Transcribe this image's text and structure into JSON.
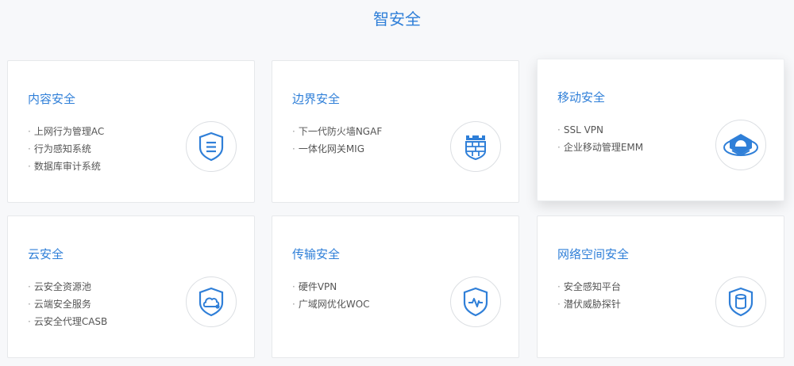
{
  "page": {
    "title": "智安全"
  },
  "colors": {
    "accent": "#2f7fd8",
    "text": "#555555",
    "card_border": "#e6e8eb"
  },
  "cards": [
    {
      "title": "内容安全",
      "icon": "shield-document-icon",
      "items": [
        "上网行为管理AC",
        "行为感知系统",
        "数据库审计系统"
      ]
    },
    {
      "title": "边界安全",
      "icon": "firewall-icon",
      "items": [
        "下一代防火墙NGAF",
        "一体化网关MIG"
      ]
    },
    {
      "title": "移动安全",
      "icon": "mobile-security-icon",
      "items": [
        "SSL VPN",
        "企业移动管理EMM"
      ]
    },
    {
      "title": "云安全",
      "icon": "cloud-shield-icon",
      "items": [
        "云安全资源池",
        "云端安全服务",
        "云安全代理CASB"
      ]
    },
    {
      "title": "传输安全",
      "icon": "transmission-shield-icon",
      "items": [
        "硬件VPN",
        "广域网优化WOC"
      ]
    },
    {
      "title": "网络空间安全",
      "icon": "cyberspace-database-icon",
      "items": [
        "安全感知平台",
        "潜伏威胁探针"
      ]
    }
  ]
}
